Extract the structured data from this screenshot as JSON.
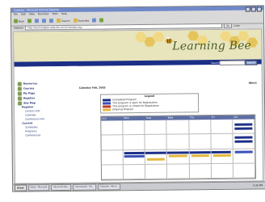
{
  "browser": {
    "title": "Calendar - Microsoft Internet Explorer",
    "menu": [
      "File",
      "Edit",
      "View",
      "Favorites",
      "Tools",
      "Help"
    ],
    "toolbar": {
      "back": "Back",
      "search": "Search",
      "favorites": "Favorites"
    },
    "address_label": "Address",
    "address": "http://learningbee.website.com/Calendar.asp",
    "go_label": "Go",
    "links_label": "Links"
  },
  "site": {
    "logo_text": "Learning Bee",
    "search_label": "Search",
    "search_button": "Search"
  },
  "sidebar": {
    "items": [
      {
        "label": "Resources",
        "icon": "book-icon"
      },
      {
        "label": "Courses",
        "icon": "notebook-icon"
      },
      {
        "label": "My Page",
        "icon": "page-icon"
      },
      {
        "label": "Register",
        "icon": "pen-icon"
      },
      {
        "label": "Site Map",
        "icon": "map-icon"
      }
    ],
    "section_label": "Register",
    "sub_items": [
      "Contact Info",
      "Calendar",
      "Conference Info"
    ],
    "group_label": "Current",
    "group_items": [
      "Schedules",
      "Programs",
      "Conferences"
    ]
  },
  "main": {
    "breadcrumb": "Calendar Feb, 2003",
    "about_label": "About"
  },
  "legend": {
    "title": "Legend",
    "rows": [
      {
        "label": "Completed Program",
        "color": "#1c2f86"
      },
      {
        "label": "This program is open for Registration",
        "color": "#3b4fb8"
      },
      {
        "label": "This program is closed for Registration",
        "color": "#c23b2a"
      },
      {
        "label": "Ongoing Program",
        "color": "#e3b73d"
      }
    ]
  },
  "calendar": {
    "days": [
      "Sun",
      "Mon",
      "Tues",
      "Wed",
      "Thu",
      "Fri",
      "Sat"
    ]
  },
  "taskbar": {
    "start": "Start",
    "tasks": [
      "Inbox - Microsoft",
      "Microsoft Out...",
      "Document1 - Mi...",
      "Calendar - Micro..."
    ],
    "clock": "4:30 PM"
  }
}
